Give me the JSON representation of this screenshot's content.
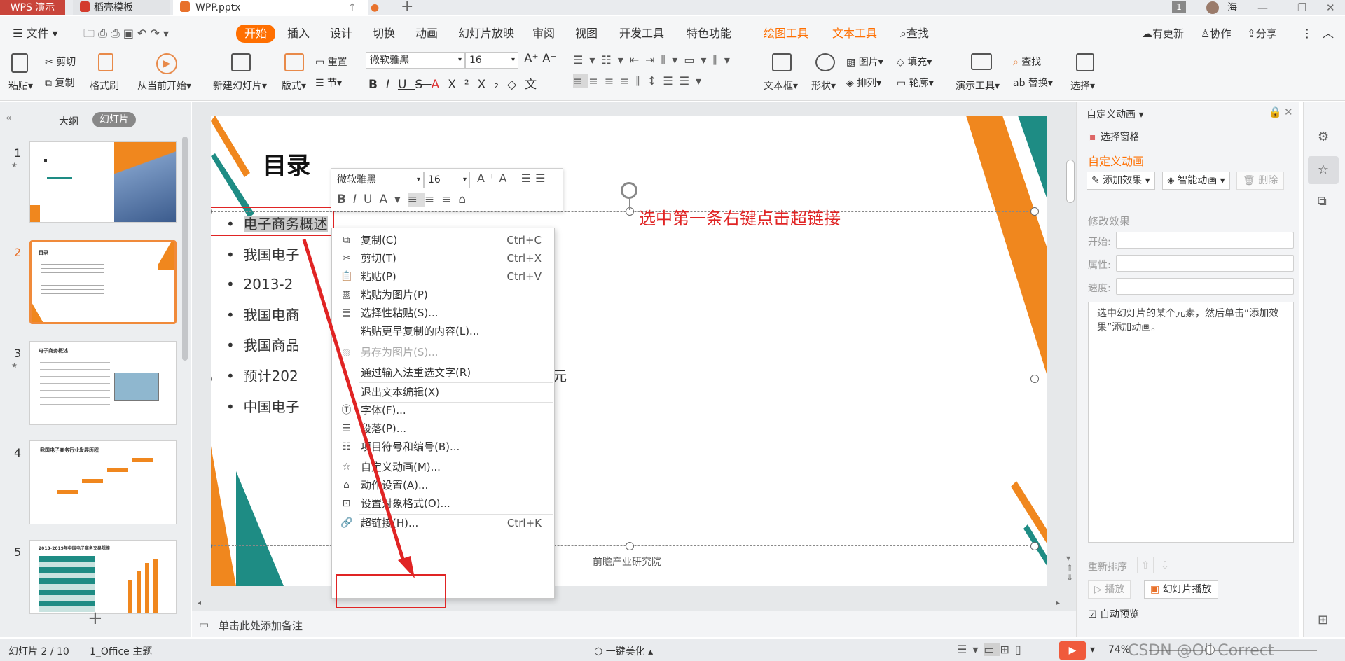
{
  "titlebar": {
    "app_tab": "WPS 演示",
    "tabs": [
      {
        "label": "稻壳模板"
      },
      {
        "label": "WPP.pptx"
      }
    ],
    "badge": "1",
    "user": "海"
  },
  "menubar": {
    "file": "文件",
    "items": [
      "开始",
      "插入",
      "设计",
      "切换",
      "动画",
      "幻灯片放映",
      "审阅",
      "视图",
      "开发工具",
      "特色功能"
    ],
    "tool_tabs": [
      "绘图工具",
      "文本工具"
    ],
    "search": "查找",
    "right": [
      "有更新",
      "协作",
      "分享"
    ]
  },
  "ribbon": {
    "paste": "粘贴",
    "cut": "剪切",
    "copy": "复制",
    "format_painter": "格式刷",
    "from_current": "从当前开始",
    "new_slide": "新建幻灯片",
    "layout": "版式",
    "reset": "重置",
    "section": "节",
    "font_name": "微软雅黑",
    "font_size": "16",
    "text_box": "文本框",
    "shape": "形状",
    "picture": "图片",
    "fill": "填充",
    "arrange": "排列",
    "outline": "轮廓",
    "present_tools": "演示工具",
    "find": "查找",
    "replace": "替换",
    "select": "选择"
  },
  "left_panel": {
    "tab_outline": "大纲",
    "tab_slides": "幻灯片",
    "slide_numbers": [
      "1",
      "2",
      "3",
      "4",
      "5"
    ],
    "selected": "2",
    "thumb2_title": "目录",
    "thumb3_title": "电子商务概述",
    "thumb4_title": "我国电子商务行业发展历程",
    "thumb5_title": "2013-2019年中国电子商务交易规模"
  },
  "slide": {
    "title": "目录",
    "bullets": [
      "电子商务概述",
      "我国电子",
      "2013-2",
      "我国电商",
      "我国商品",
      "预计202",
      "中国电子"
    ],
    "bullet6_tail": "元",
    "annotation": "选中第一条右键点击超链接",
    "footer": "前瞻产业研究院"
  },
  "mini_toolbar": {
    "font_name": "微软雅黑",
    "font_size": "16"
  },
  "context_menu": {
    "items": [
      {
        "label": "复制(C)",
        "shortcut": "Ctrl+C"
      },
      {
        "label": "剪切(T)",
        "shortcut": "Ctrl+X"
      },
      {
        "label": "粘贴(P)",
        "shortcut": "Ctrl+V"
      },
      {
        "label": "粘贴为图片(P)",
        "shortcut": ""
      },
      {
        "label": "选择性粘贴(S)...",
        "shortcut": ""
      },
      {
        "label": "粘贴更早复制的内容(L)...",
        "shortcut": ""
      },
      {
        "label": "另存为图片(S)...",
        "shortcut": ""
      },
      {
        "label": "通过输入法重选文字(R)",
        "shortcut": ""
      },
      {
        "label": "退出文本编辑(X)",
        "shortcut": ""
      },
      {
        "label": "字体(F)...",
        "shortcut": ""
      },
      {
        "label": "段落(P)...",
        "shortcut": ""
      },
      {
        "label": "项目符号和编号(B)...",
        "shortcut": ""
      },
      {
        "label": "自定义动画(M)...",
        "shortcut": ""
      },
      {
        "label": "动作设置(A)...",
        "shortcut": ""
      },
      {
        "label": "设置对象格式(O)...",
        "shortcut": ""
      },
      {
        "label": "超链接(H)...",
        "shortcut": "Ctrl+K"
      }
    ]
  },
  "right_panel": {
    "header": "自定义动画",
    "selection_pane": "选择窗格",
    "section_title": "自定义动画",
    "add_effect": "添加效果",
    "smart_anim": "智能动画",
    "delete": "删除",
    "modify": "修改效果",
    "start": "开始:",
    "property": "属性:",
    "speed": "速度:",
    "hint": "选中幻灯片的某个元素，然后单击“添加效果”添加动画。",
    "reorder": "重新排序",
    "play": "播放",
    "slideshow": "幻灯片播放",
    "autopreview": "自动预览"
  },
  "notes": "单击此处添加备注",
  "statusbar": {
    "slide_info": "幻灯片 2 / 10",
    "theme": "1_Office 主题",
    "beautify": "一键美化",
    "zoom": "74%",
    "watermark": "CSDN @Oll Correct"
  },
  "colors": {
    "accent": "#ff6f00",
    "annotation_red": "#e02424",
    "teal": "#1e8c84",
    "orange": "#f0871e"
  }
}
